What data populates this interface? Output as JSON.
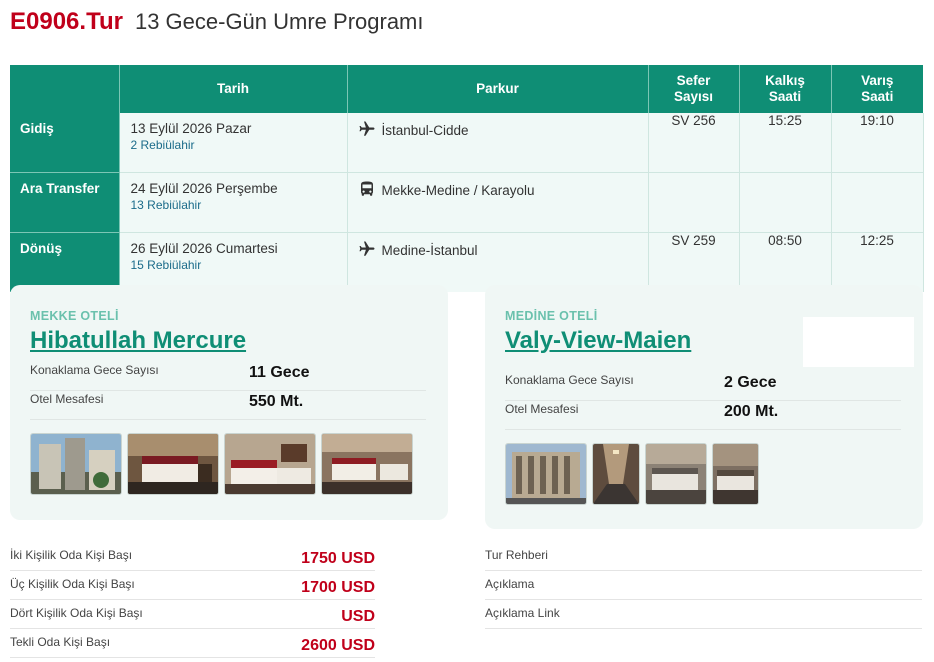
{
  "header": {
    "code": "E0906.Tur",
    "title": "13 Gece-Gün Umre Programı"
  },
  "flights": {
    "columns": {
      "tarih": "Tarih",
      "parkur": "Parkur",
      "sefer": [
        "Sefer",
        "Sayısı"
      ],
      "kalkis": [
        "Kalkış",
        "Saati"
      ],
      "varis": [
        "Varış",
        "Saati"
      ]
    },
    "rows": [
      {
        "type": "Gidiş",
        "date": "13 Eylül 2026 Pazar",
        "hijri": "2 Rebiülahir",
        "route_icon": "plane-icon",
        "route": "İstanbul-Cidde",
        "flight": "SV 256",
        "dep": "15:25",
        "arr": "19:10"
      },
      {
        "type": "Ara Transfer",
        "date": "24 Eylül 2026 Perşembe",
        "hijri": "13 Rebiülahir",
        "route_icon": "bus-icon",
        "route": "Mekke-Medine / Karayolu",
        "flight": "",
        "dep": "",
        "arr": ""
      },
      {
        "type": "Dönüş",
        "date": "26 Eylül 2026 Cumartesi",
        "hijri": "15 Rebiülahir",
        "route_icon": "plane-icon",
        "route": "Medine-İstanbul",
        "flight": "SV 259",
        "dep": "08:50",
        "arr": "12:25"
      }
    ]
  },
  "hotels": {
    "mekke": {
      "label": "MEKKE OTELİ",
      "name": "Hibatullah Mercure",
      "nights_label": "Konaklama Gece Sayısı",
      "nights": "11 Gece",
      "distance_label": "Otel Mesafesi",
      "distance": "550 Mt."
    },
    "medine": {
      "label": "MEDİNE OTELİ",
      "name": "Valy-View-Maien",
      "nights_label": "Konaklama Gece Sayısı",
      "nights": "2 Gece",
      "distance_label": "Otel Mesafesi",
      "distance": "200 Mt."
    }
  },
  "prices": [
    {
      "label": "İki Kişilik Oda Kişi Başı",
      "value": "1750 USD"
    },
    {
      "label": "Üç Kişilik Oda Kişi Başı",
      "value": "1700 USD"
    },
    {
      "label": "Dört Kişilik Oda Kişi Başı",
      "value": "USD"
    },
    {
      "label": "Tekli Oda Kişi Başı",
      "value": "2600 USD"
    }
  ],
  "info": [
    {
      "label": "Tur Rehberi"
    },
    {
      "label": "Açıklama"
    },
    {
      "label": "Açıklama Link"
    }
  ],
  "colors": {
    "accent": "#0f8e75",
    "price": "#c0001a",
    "code": "#c0001a"
  }
}
